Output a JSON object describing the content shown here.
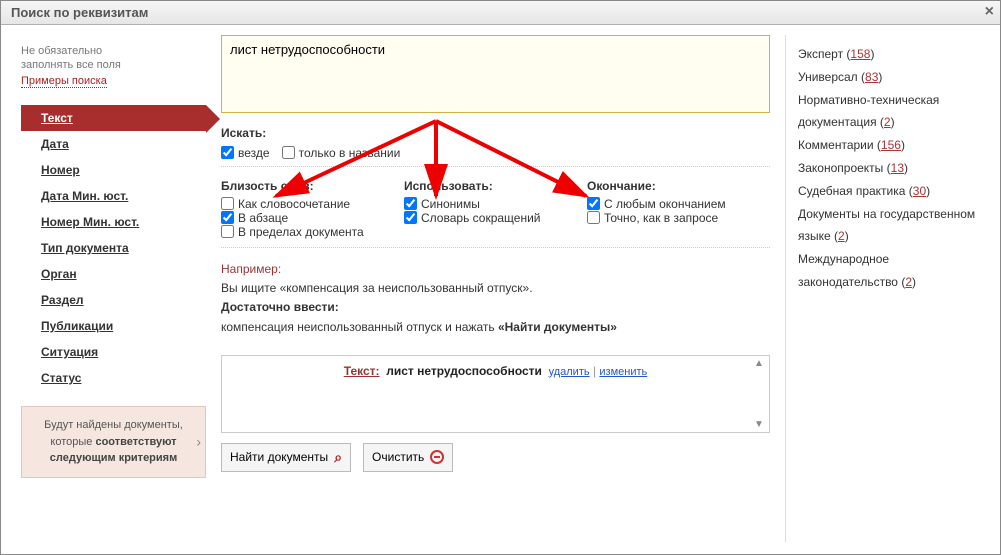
{
  "title": "Поиск по реквизитам",
  "hint1": "Не обязательно",
  "hint2": "заполнять все поля",
  "examples_link": "Примеры поиска",
  "nav": [
    "Текст",
    "Дата",
    "Номер",
    "Дата Мин. юст.",
    "Номер Мин. юст.",
    "Тип документа",
    "Орган",
    "Раздел",
    "Публикации",
    "Ситуация",
    "Статус"
  ],
  "criteria_before": "Будут найдены документы, которые ",
  "criteria_bold": "соответствуют следующим критериям",
  "search_value": "лист нетрудоспособности",
  "search_section": "Искать:",
  "search_chk": [
    {
      "label": "везде",
      "checked": true
    },
    {
      "label": "только в названии",
      "checked": false
    }
  ],
  "col_titles": [
    "Близость слов:",
    "Использовать:",
    "Окончание:"
  ],
  "proximity": [
    {
      "label": "Как словосочетание",
      "checked": false
    },
    {
      "label": "В абзаце",
      "checked": true
    },
    {
      "label": "В пределах документа",
      "checked": false
    }
  ],
  "use": [
    {
      "label": "Синонимы",
      "checked": true
    },
    {
      "label": "Словарь сокращений",
      "checked": true
    }
  ],
  "ending": [
    {
      "label": "С любым окончанием",
      "checked": true
    },
    {
      "label": "Точно, как в запросе",
      "checked": false
    }
  ],
  "example": {
    "hdr": "Например:",
    "line1": "Вы ищите «компенсация за неиспользованный отпуск».",
    "bold2": "Достаточно ввести:",
    "line2a": "компенсация неиспользованный отпуск и нажать ",
    "line2b": "«Найти документы»"
  },
  "result": {
    "label": "Текст:",
    "value": "лист нетрудоспособности",
    "del": "удалить",
    "edit": "изменить"
  },
  "btn_find": "Найти документы",
  "btn_clear": "Очистить",
  "right": [
    {
      "label": "Эксперт",
      "count": "158"
    },
    {
      "label": "Универсал",
      "count": "83"
    },
    {
      "label": "Нормативно-техническая документация",
      "count": "2"
    },
    {
      "label": "Комментарии",
      "count": "156"
    },
    {
      "label": "Законопроекты",
      "count": "13"
    },
    {
      "label": "Судебная практика",
      "count": "30"
    },
    {
      "label": "Документы на государственном языке",
      "count": "2"
    },
    {
      "label": "Международное законодательство",
      "count": "2"
    }
  ]
}
